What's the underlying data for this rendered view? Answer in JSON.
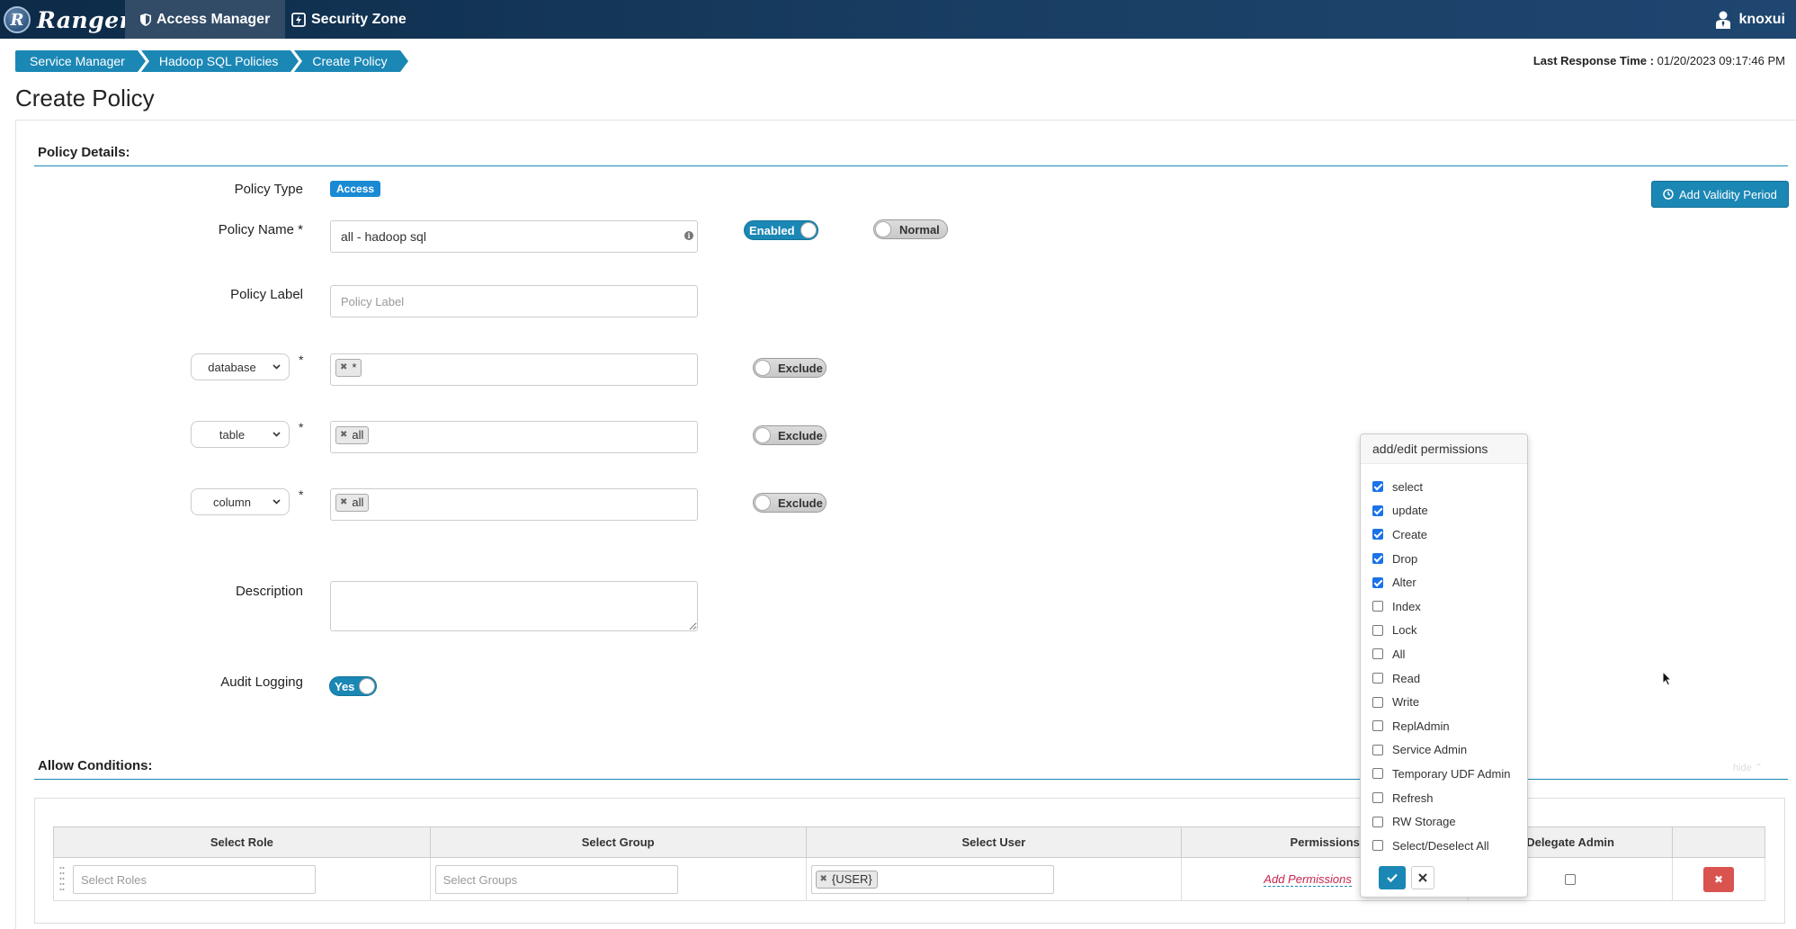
{
  "navbar": {
    "brand": "Ranger",
    "brand_logo_letter": "R",
    "items": [
      {
        "label": "Access Manager",
        "icon": "shield-icon",
        "active": true
      },
      {
        "label": "Security Zone",
        "icon": "zone-icon",
        "active": false
      }
    ],
    "user": {
      "name": "knoxui",
      "icon": "user-icon"
    }
  },
  "breadcrumb": [
    "Service Manager",
    "Hadoop SQL Policies",
    "Create Policy"
  ],
  "last_response": {
    "label": "Last Response Time :",
    "value": "01/20/2023 09:17:46 PM"
  },
  "page_title": "Create Policy",
  "policy_details": {
    "section_title": "Policy Details:",
    "policy_type_label": "Policy Type",
    "policy_type_value": "Access",
    "policy_name_label": "Policy Name *",
    "policy_name_value": "all - hadoop sql",
    "enabled_toggle": "Enabled",
    "normal_toggle": "Normal",
    "policy_label_label": "Policy Label",
    "policy_label_placeholder": "Policy Label",
    "add_validity_period": "Add Validity Period",
    "resources": [
      {
        "select": "database",
        "required": "*",
        "tag": "*",
        "exclude": "Exclude"
      },
      {
        "select": "table",
        "required": "*",
        "tag": "all",
        "exclude": "Exclude"
      },
      {
        "select": "column",
        "required": "*",
        "tag": "all",
        "exclude": "Exclude"
      }
    ],
    "description_label": "Description",
    "audit_logging_label": "Audit Logging",
    "audit_logging_value": "Yes"
  },
  "allow_conditions": {
    "section_title": "Allow Conditions:",
    "hide_link": "hide",
    "columns": [
      "Select Role",
      "Select Group",
      "Select User",
      "Permissions",
      "Delegate Admin",
      ""
    ],
    "row": {
      "roles_placeholder": "Select Roles",
      "groups_placeholder": "Select Groups",
      "user_tag": "{USER}",
      "add_permissions": "Add Permissions",
      "delete_icon": "close-icon"
    }
  },
  "permissions_popover": {
    "title": "add/edit permissions",
    "items": [
      {
        "label": "select",
        "checked": true
      },
      {
        "label": "update",
        "checked": true
      },
      {
        "label": "Create",
        "checked": true
      },
      {
        "label": "Drop",
        "checked": true
      },
      {
        "label": "Alter",
        "checked": true
      },
      {
        "label": "Index",
        "checked": false
      },
      {
        "label": "Lock",
        "checked": false
      },
      {
        "label": "All",
        "checked": false
      },
      {
        "label": "Read",
        "checked": false
      },
      {
        "label": "Write",
        "checked": false
      },
      {
        "label": "ReplAdmin",
        "checked": false
      },
      {
        "label": "Service Admin",
        "checked": false
      },
      {
        "label": "Temporary UDF Admin",
        "checked": false
      },
      {
        "label": "Refresh",
        "checked": false
      },
      {
        "label": "RW Storage",
        "checked": false
      },
      {
        "label": "Select/Deselect All",
        "checked": false
      }
    ],
    "ok_icon": "check-icon",
    "cancel_icon": "close-icon"
  },
  "colors": {
    "brand_blue": "#1b87b5",
    "navbar": "#193e63",
    "danger": "#d9534f",
    "link": "#c7254e"
  }
}
